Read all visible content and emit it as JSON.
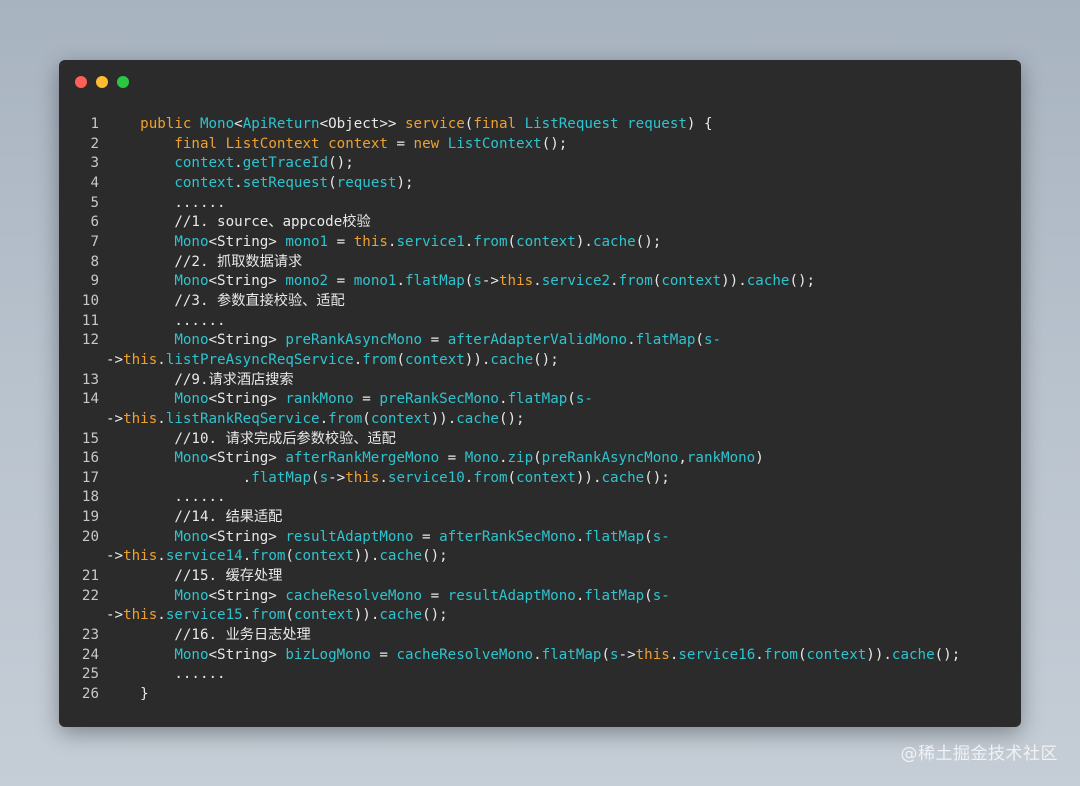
{
  "window": {
    "traffic_lights": [
      {
        "name": "close",
        "color": "#fe5f57"
      },
      {
        "name": "minimize",
        "color": "#febc2e"
      },
      {
        "name": "maximize",
        "color": "#28c840"
      }
    ]
  },
  "colors": {
    "keyword": "#f0a030",
    "identifier": "#2ec4cf",
    "plain": "#e8e8e8",
    "background": "#2b2b2b"
  },
  "code_lines": [
    {
      "n": "1",
      "tokens": [
        [
          "pl",
          "    "
        ],
        [
          "kw",
          "public"
        ],
        [
          "pl",
          " "
        ],
        [
          "ty",
          "Mono"
        ],
        [
          "pl",
          "<"
        ],
        [
          "ty",
          "ApiReturn"
        ],
        [
          "pl",
          "<Object>> "
        ],
        [
          "kw",
          "service"
        ],
        [
          "pl",
          "("
        ],
        [
          "kw",
          "final"
        ],
        [
          "pl",
          " "
        ],
        [
          "ty",
          "ListRequest"
        ],
        [
          "pl",
          " "
        ],
        [
          "ty",
          "request"
        ],
        [
          "pl",
          ") {"
        ]
      ]
    },
    {
      "n": "2",
      "tokens": [
        [
          "pl",
          "        "
        ],
        [
          "kw",
          "final"
        ],
        [
          "pl",
          " "
        ],
        [
          "kw",
          "ListContext"
        ],
        [
          "pl",
          " "
        ],
        [
          "kw",
          "context"
        ],
        [
          "pl",
          " = "
        ],
        [
          "kw",
          "new"
        ],
        [
          "pl",
          " "
        ],
        [
          "ty",
          "ListContext"
        ],
        [
          "pl",
          "();"
        ]
      ]
    },
    {
      "n": "3",
      "tokens": [
        [
          "pl",
          "        "
        ],
        [
          "ty",
          "context"
        ],
        [
          "pl",
          "."
        ],
        [
          "fn",
          "getTraceId"
        ],
        [
          "pl",
          "();"
        ]
      ]
    },
    {
      "n": "4",
      "tokens": [
        [
          "pl",
          "        "
        ],
        [
          "ty",
          "context"
        ],
        [
          "pl",
          "."
        ],
        [
          "fn",
          "setRequest"
        ],
        [
          "pl",
          "("
        ],
        [
          "ty",
          "request"
        ],
        [
          "pl",
          ");"
        ]
      ]
    },
    {
      "n": "5",
      "tokens": [
        [
          "pl",
          "        ......"
        ]
      ]
    },
    {
      "n": "6",
      "tokens": [
        [
          "cm",
          "        //1. source、appcode校验"
        ]
      ]
    },
    {
      "n": "7",
      "tokens": [
        [
          "pl",
          "        "
        ],
        [
          "ty",
          "Mono"
        ],
        [
          "pl",
          "<String> "
        ],
        [
          "ty",
          "mono1"
        ],
        [
          "pl",
          " = "
        ],
        [
          "kw",
          "this"
        ],
        [
          "pl",
          "."
        ],
        [
          "ty",
          "service1"
        ],
        [
          "pl",
          "."
        ],
        [
          "fn",
          "from"
        ],
        [
          "pl",
          "("
        ],
        [
          "ty",
          "context"
        ],
        [
          "pl",
          ")."
        ],
        [
          "fn",
          "cache"
        ],
        [
          "pl",
          "();"
        ]
      ]
    },
    {
      "n": "8",
      "tokens": [
        [
          "cm",
          "        //2. 抓取数据请求"
        ]
      ]
    },
    {
      "n": "9",
      "tokens": [
        [
          "pl",
          "        "
        ],
        [
          "ty",
          "Mono"
        ],
        [
          "pl",
          "<String> "
        ],
        [
          "ty",
          "mono2"
        ],
        [
          "pl",
          " = "
        ],
        [
          "ty",
          "mono1"
        ],
        [
          "pl",
          "."
        ],
        [
          "fn",
          "flatMap"
        ],
        [
          "pl",
          "("
        ],
        [
          "ty",
          "s"
        ],
        [
          "pl",
          "->"
        ],
        [
          "kw",
          "this"
        ],
        [
          "pl",
          "."
        ],
        [
          "ty",
          "service2"
        ],
        [
          "pl",
          "."
        ],
        [
          "fn",
          "from"
        ],
        [
          "pl",
          "("
        ],
        [
          "ty",
          "context"
        ],
        [
          "pl",
          "))."
        ],
        [
          "fn",
          "cache"
        ],
        [
          "pl",
          "();"
        ]
      ]
    },
    {
      "n": "10",
      "tokens": [
        [
          "cm",
          "        //3. 参数直接校验、适配"
        ]
      ]
    },
    {
      "n": "11",
      "tokens": [
        [
          "pl",
          "        ......"
        ]
      ]
    },
    {
      "n": "12",
      "tokens": [
        [
          "pl",
          "        "
        ],
        [
          "ty",
          "Mono"
        ],
        [
          "pl",
          "<String> "
        ],
        [
          "ty",
          "preRankAsyncMono"
        ],
        [
          "pl",
          " = "
        ],
        [
          "ty",
          "afterAdapterValidMono"
        ],
        [
          "pl",
          "."
        ],
        [
          "fn",
          "flatMap"
        ],
        [
          "pl",
          "("
        ],
        [
          "ty",
          "s-"
        ]
      ]
    },
    {
      "n": "",
      "tokens": [
        [
          "pl",
          "->"
        ],
        [
          "kw",
          "this"
        ],
        [
          "pl",
          "."
        ],
        [
          "ty",
          "listPreAsyncReqService"
        ],
        [
          "pl",
          "."
        ],
        [
          "fn",
          "from"
        ],
        [
          "pl",
          "("
        ],
        [
          "ty",
          "context"
        ],
        [
          "pl",
          "))."
        ],
        [
          "fn",
          "cache"
        ],
        [
          "pl",
          "();"
        ]
      ],
      "wrap": true
    },
    {
      "n": "13",
      "tokens": [
        [
          "cm",
          "        //9.请求酒店搜索"
        ]
      ]
    },
    {
      "n": "14",
      "tokens": [
        [
          "pl",
          "        "
        ],
        [
          "ty",
          "Mono"
        ],
        [
          "pl",
          "<String> "
        ],
        [
          "ty",
          "rankMono"
        ],
        [
          "pl",
          " = "
        ],
        [
          "ty",
          "preRankSecMono"
        ],
        [
          "pl",
          "."
        ],
        [
          "fn",
          "flatMap"
        ],
        [
          "pl",
          "("
        ],
        [
          "ty",
          "s-"
        ]
      ]
    },
    {
      "n": "",
      "tokens": [
        [
          "pl",
          "->"
        ],
        [
          "kw",
          "this"
        ],
        [
          "pl",
          "."
        ],
        [
          "ty",
          "listRankReqService"
        ],
        [
          "pl",
          "."
        ],
        [
          "fn",
          "from"
        ],
        [
          "pl",
          "("
        ],
        [
          "ty",
          "context"
        ],
        [
          "pl",
          "))."
        ],
        [
          "fn",
          "cache"
        ],
        [
          "pl",
          "();"
        ]
      ],
      "wrap": true
    },
    {
      "n": "15",
      "tokens": [
        [
          "cm",
          "        //10. 请求完成后参数校验、适配"
        ]
      ]
    },
    {
      "n": "16",
      "tokens": [
        [
          "pl",
          "        "
        ],
        [
          "ty",
          "Mono"
        ],
        [
          "pl",
          "<String> "
        ],
        [
          "ty",
          "afterRankMergeMono"
        ],
        [
          "pl",
          " = "
        ],
        [
          "ty",
          "Mono"
        ],
        [
          "pl",
          "."
        ],
        [
          "fn",
          "zip"
        ],
        [
          "pl",
          "("
        ],
        [
          "ty",
          "preRankAsyncMono"
        ],
        [
          "pl",
          ","
        ],
        [
          "ty",
          "rankMono"
        ],
        [
          "pl",
          ")"
        ]
      ]
    },
    {
      "n": "17",
      "tokens": [
        [
          "pl",
          "                ."
        ],
        [
          "fn",
          "flatMap"
        ],
        [
          "pl",
          "("
        ],
        [
          "ty",
          "s"
        ],
        [
          "pl",
          "->"
        ],
        [
          "kw",
          "this"
        ],
        [
          "pl",
          "."
        ],
        [
          "ty",
          "service10"
        ],
        [
          "pl",
          "."
        ],
        [
          "fn",
          "from"
        ],
        [
          "pl",
          "("
        ],
        [
          "ty",
          "context"
        ],
        [
          "pl",
          "))."
        ],
        [
          "fn",
          "cache"
        ],
        [
          "pl",
          "();"
        ]
      ]
    },
    {
      "n": "18",
      "tokens": [
        [
          "pl",
          "        ......"
        ]
      ]
    },
    {
      "n": "19",
      "tokens": [
        [
          "cm",
          "        //14. 结果适配"
        ]
      ]
    },
    {
      "n": "20",
      "tokens": [
        [
          "pl",
          "        "
        ],
        [
          "ty",
          "Mono"
        ],
        [
          "pl",
          "<String> "
        ],
        [
          "ty",
          "resultAdaptMono"
        ],
        [
          "pl",
          " = "
        ],
        [
          "ty",
          "afterRankSecMono"
        ],
        [
          "pl",
          "."
        ],
        [
          "fn",
          "flatMap"
        ],
        [
          "pl",
          "("
        ],
        [
          "ty",
          "s-"
        ]
      ]
    },
    {
      "n": "",
      "tokens": [
        [
          "pl",
          "->"
        ],
        [
          "kw",
          "this"
        ],
        [
          "pl",
          "."
        ],
        [
          "ty",
          "service14"
        ],
        [
          "pl",
          "."
        ],
        [
          "fn",
          "from"
        ],
        [
          "pl",
          "("
        ],
        [
          "ty",
          "context"
        ],
        [
          "pl",
          "))."
        ],
        [
          "fn",
          "cache"
        ],
        [
          "pl",
          "();"
        ]
      ],
      "wrap": true
    },
    {
      "n": "21",
      "tokens": [
        [
          "cm",
          "        //15. 缓存处理"
        ]
      ]
    },
    {
      "n": "22",
      "tokens": [
        [
          "pl",
          "        "
        ],
        [
          "ty",
          "Mono"
        ],
        [
          "pl",
          "<String> "
        ],
        [
          "ty",
          "cacheResolveMono"
        ],
        [
          "pl",
          " = "
        ],
        [
          "ty",
          "resultAdaptMono"
        ],
        [
          "pl",
          "."
        ],
        [
          "fn",
          "flatMap"
        ],
        [
          "pl",
          "("
        ],
        [
          "ty",
          "s-"
        ]
      ]
    },
    {
      "n": "",
      "tokens": [
        [
          "pl",
          "->"
        ],
        [
          "kw",
          "this"
        ],
        [
          "pl",
          "."
        ],
        [
          "ty",
          "service15"
        ],
        [
          "pl",
          "."
        ],
        [
          "fn",
          "from"
        ],
        [
          "pl",
          "("
        ],
        [
          "ty",
          "context"
        ],
        [
          "pl",
          "))."
        ],
        [
          "fn",
          "cache"
        ],
        [
          "pl",
          "();"
        ]
      ],
      "wrap": true
    },
    {
      "n": "23",
      "tokens": [
        [
          "cm",
          "        //16. 业务日志处理"
        ]
      ]
    },
    {
      "n": "24",
      "tokens": [
        [
          "pl",
          "        "
        ],
        [
          "ty",
          "Mono"
        ],
        [
          "pl",
          "<String> "
        ],
        [
          "ty",
          "bizLogMono"
        ],
        [
          "pl",
          " = "
        ],
        [
          "ty",
          "cacheResolveMono"
        ],
        [
          "pl",
          "."
        ],
        [
          "fn",
          "flatMap"
        ],
        [
          "pl",
          "("
        ],
        [
          "ty",
          "s"
        ],
        [
          "pl",
          "->"
        ],
        [
          "kw",
          "this"
        ],
        [
          "pl",
          "."
        ],
        [
          "ty",
          "service16"
        ],
        [
          "pl",
          "."
        ],
        [
          "fn",
          "from"
        ],
        [
          "pl",
          "("
        ],
        [
          "ty",
          "context"
        ],
        [
          "pl",
          "))."
        ],
        [
          "fn",
          "cache"
        ],
        [
          "pl",
          "();"
        ]
      ]
    },
    {
      "n": "25",
      "tokens": [
        [
          "pl",
          "        ......"
        ]
      ]
    },
    {
      "n": "26",
      "tokens": [
        [
          "pl",
          "    }"
        ]
      ]
    }
  ],
  "watermark": "@稀土掘金技术社区"
}
